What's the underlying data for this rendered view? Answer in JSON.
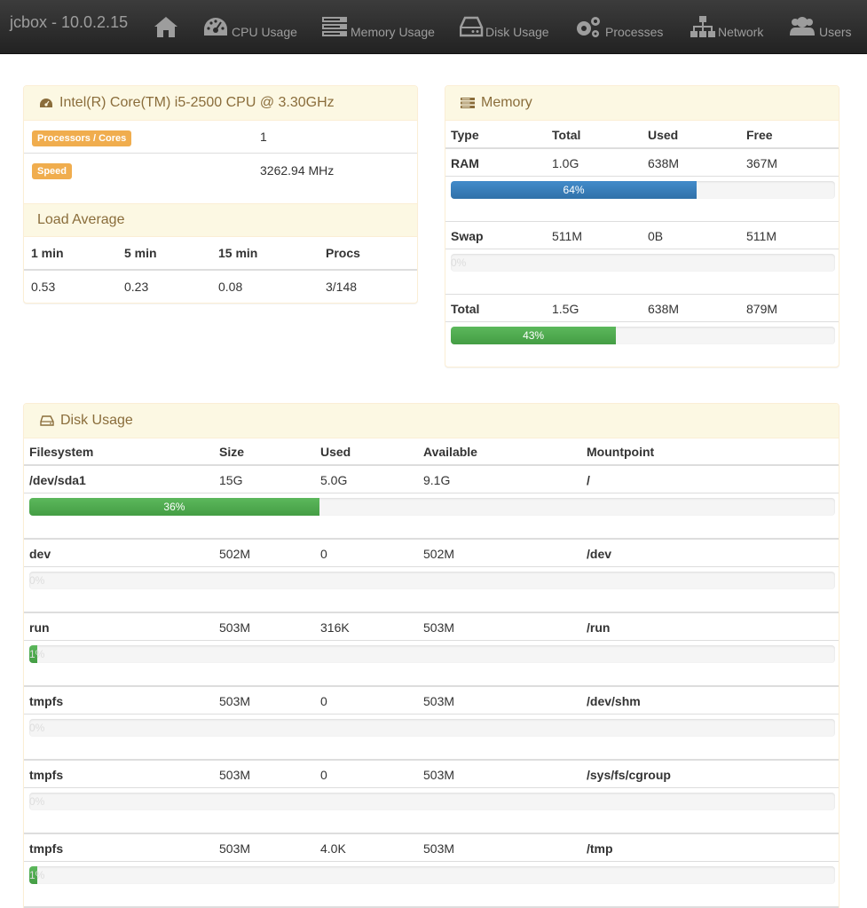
{
  "nav": {
    "brand": "jcbox - 10.0.2.15",
    "items": [
      {
        "label": "",
        "icon": "home-icon"
      },
      {
        "label": "CPU Usage",
        "icon": "dashboard-icon"
      },
      {
        "label": "Memory Usage",
        "icon": "server-icon"
      },
      {
        "label": "Disk Usage",
        "icon": "hdd-icon"
      },
      {
        "label": "Processes",
        "icon": "gears-icon"
      },
      {
        "label": "Network",
        "icon": "sitemap-icon"
      },
      {
        "label": "Users",
        "icon": "users-icon"
      }
    ]
  },
  "colors": {
    "navbar": "#222222",
    "panel_header": "#fcf8e3",
    "panel_title": "#8a6d3b",
    "badge": "#f0ad4e",
    "bar_blue": "#428bca",
    "bar_green": "#5cb85c"
  },
  "cpu": {
    "title": "Intel(R) Core(TM) i5-2500 CPU @ 3.30GHz",
    "rows": [
      {
        "label": "Processors / Cores",
        "value": "1"
      },
      {
        "label": "Speed",
        "value": "3262.94 MHz"
      }
    ]
  },
  "load": {
    "title": "Load Average",
    "headers": [
      "1 min",
      "5 min",
      "15 min",
      "Procs"
    ],
    "values": [
      "0.53",
      "0.23",
      "0.08",
      "3/148"
    ]
  },
  "memory": {
    "title": "Memory",
    "headers": [
      "Type",
      "Total",
      "Used",
      "Free"
    ],
    "rows": [
      {
        "type": "RAM",
        "total": "1.0G",
        "used": "638M",
        "free": "367M",
        "percent": 64,
        "percent_label": "64%",
        "color": "blue"
      },
      {
        "type": "Swap",
        "total": "511M",
        "used": "0B",
        "free": "511M",
        "percent": 0,
        "percent_label": "0%",
        "color": "green"
      },
      {
        "type": "Total",
        "total": "1.5G",
        "used": "638M",
        "free": "879M",
        "percent": 43,
        "percent_label": "43%",
        "color": "green"
      }
    ]
  },
  "disk": {
    "title": "Disk Usage",
    "headers": [
      "Filesystem",
      "Size",
      "Used",
      "Available",
      "Mountpoint"
    ],
    "rows": [
      {
        "fs": "/dev/sda1",
        "size": "15G",
        "used": "5.0G",
        "avail": "9.1G",
        "mount": "/",
        "percent": 36,
        "percent_label": "36%"
      },
      {
        "fs": "dev",
        "size": "502M",
        "used": "0",
        "avail": "502M",
        "mount": "/dev",
        "percent": 0,
        "percent_label": "0%"
      },
      {
        "fs": "run",
        "size": "503M",
        "used": "316K",
        "avail": "503M",
        "mount": "/run",
        "percent": 1,
        "percent_label": "1%"
      },
      {
        "fs": "tmpfs",
        "size": "503M",
        "used": "0",
        "avail": "503M",
        "mount": "/dev/shm",
        "percent": 0,
        "percent_label": "0%"
      },
      {
        "fs": "tmpfs",
        "size": "503M",
        "used": "0",
        "avail": "503M",
        "mount": "/sys/fs/cgroup",
        "percent": 0,
        "percent_label": "0%"
      },
      {
        "fs": "tmpfs",
        "size": "503M",
        "used": "4.0K",
        "avail": "503M",
        "mount": "/tmp",
        "percent": 1,
        "percent_label": "1%"
      }
    ]
  }
}
